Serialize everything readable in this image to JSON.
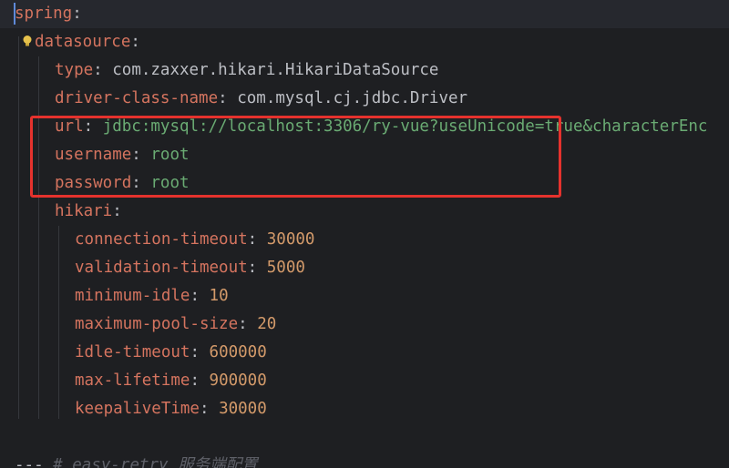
{
  "editor": {
    "language": "yaml",
    "lines": [
      {
        "key": "spring",
        "sep": ":"
      },
      {
        "key": "datasource",
        "sep": ":"
      },
      {
        "key": "type",
        "sep": ":",
        "value": "com.zaxxer.hikari.HikariDataSource"
      },
      {
        "key": "driver-class-name",
        "sep": ":",
        "value": "com.mysql.cj.jdbc.Driver"
      },
      {
        "key": "url",
        "sep": ":",
        "value": "jdbc:mysql://localhost:3306/ry-vue?useUnicode=true&characterEnc"
      },
      {
        "key": "username",
        "sep": ":",
        "value": "root"
      },
      {
        "key": "password",
        "sep": ":",
        "value": "root"
      },
      {
        "key": "hikari",
        "sep": ":"
      },
      {
        "key": "connection-timeout",
        "sep": ":",
        "value": "30000"
      },
      {
        "key": "validation-timeout",
        "sep": ":",
        "value": "5000"
      },
      {
        "key": "minimum-idle",
        "sep": ":",
        "value": "10"
      },
      {
        "key": "maximum-pool-size",
        "sep": ":",
        "value": "20"
      },
      {
        "key": "idle-timeout",
        "sep": ":",
        "value": "600000"
      },
      {
        "key": "max-lifetime",
        "sep": ":",
        "value": "900000"
      },
      {
        "key": "keepaliveTime",
        "sep": ":",
        "value": "30000"
      }
    ],
    "footer_line": {
      "dashes": "---",
      "comment": "# easy-retry 服务端配置"
    }
  },
  "colors": {
    "background": "#1e1f22",
    "key": "#d5745f",
    "string": "#6aab73",
    "number": "#d39a6a",
    "highlight": "#e5322d"
  }
}
